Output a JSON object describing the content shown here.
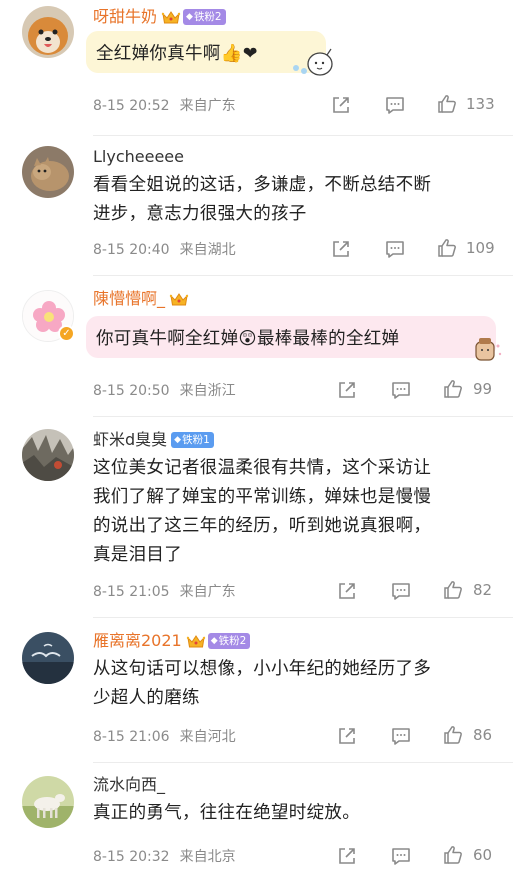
{
  "icons": {
    "share": "share-icon",
    "comment": "comment-icon",
    "like": "like-icon"
  },
  "comments": [
    {
      "username": "呀甜牛奶",
      "fan_badge": "铁粉2",
      "text": "全红婵你真牛啊👍❤",
      "timestamp": "8-15 20:52",
      "location": "来自广东",
      "likes": "133"
    },
    {
      "username": "Llycheeeee",
      "text": "看看全姐说的这话，多谦虚，不断总结不断进步，意志力很强大的孩子",
      "text_line1": "看看全姐说的这话，多谦虚，不断总结不断",
      "text_line2": "进步，意志力很强大的孩子",
      "timestamp": "8-15 20:40",
      "location": "来自湖北",
      "likes": "109"
    },
    {
      "username": "陳懵懵啊_",
      "text": "你可真牛啊全红婵😲最棒最棒的全红婵",
      "timestamp": "8-15 20:50",
      "location": "来自浙江",
      "likes": "99"
    },
    {
      "username": "虾米d臭臭",
      "fan_badge": "铁粉1",
      "text_line1": "这位美女记者很温柔很有共情，这个采访让",
      "text_line2": "我们了解了婵宝的平常训练，婵妹也是慢慢",
      "text_line3": "的说出了这三年的经历，听到她说真狠啊，",
      "text_line4": "真是泪目了",
      "timestamp": "8-15 21:05",
      "location": "来自广东",
      "likes": "82"
    },
    {
      "username": "雁离离2021",
      "fan_badge": "铁粉2",
      "text_line1": "从这句话可以想像，小小年纪的她经历了多",
      "text_line2": "少超人的磨练",
      "timestamp": "8-15 21:06",
      "location": "来自河北",
      "likes": "86"
    },
    {
      "username": "流水向西_",
      "text": "真正的勇气，往往在绝望时绽放。",
      "timestamp": "8-15 20:32",
      "location": "来自北京",
      "likes": "60"
    }
  ]
}
